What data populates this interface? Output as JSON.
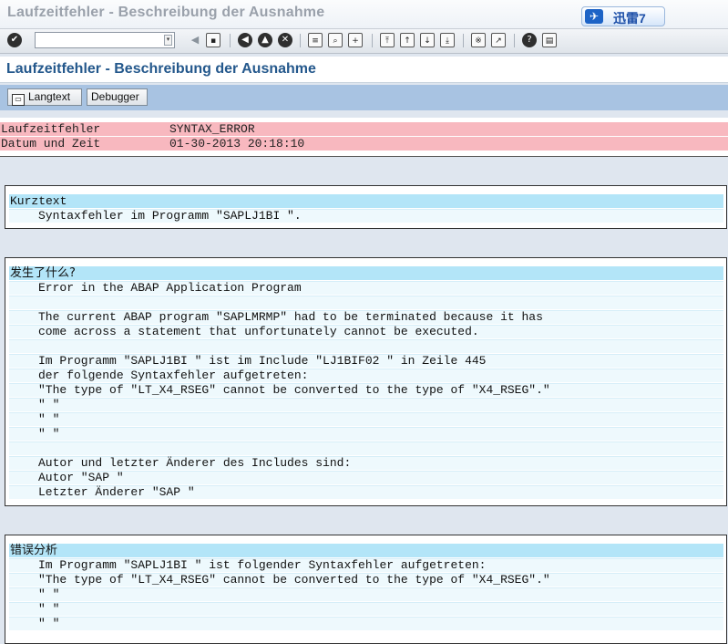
{
  "window": {
    "title": "Laufzeitfehler - Beschreibung der Ausnahme"
  },
  "xunlei": {
    "label": "迅雷7"
  },
  "toolbar": {
    "buttons": [
      "enter-icon",
      "back-icon",
      "save-icon",
      "back-nav-icon",
      "exit-icon",
      "cancel-icon",
      "print-icon",
      "find-icon",
      "find-next-icon",
      "first-page-icon",
      "prev-page-icon",
      "next-page-icon",
      "last-page-icon",
      "new-session-icon",
      "shortcut-icon",
      "help-icon",
      "layout-icon"
    ]
  },
  "page": {
    "heading": "Laufzeitfehler - Beschreibung der Ausnahme"
  },
  "appbar": {
    "langtext": "Langtext",
    "debugger": "Debugger"
  },
  "error": {
    "rows": [
      {
        "key": "Laufzeitfehler",
        "value": "SYNTAX_ERROR"
      },
      {
        "key": "Datum und Zeit",
        "value": "01-30-2013 20:18:10"
      }
    ]
  },
  "kurztext": {
    "title": "Kurztext",
    "lines": [
      "Syntaxfehler im Programm \"SAPLJ1BI \"."
    ]
  },
  "what": {
    "title": "发生了什么?",
    "lines": [
      "Error in the ABAP Application Program",
      "",
      "The current ABAP program \"SAPLMRMP\" had to be terminated because it has",
      "come across a statement that unfortunately cannot be executed.",
      "",
      "Im Programm \"SAPLJ1BI \" ist im Include \"LJ1BIF02 \" in Zeile 445",
      "der folgende Syntaxfehler aufgetreten:",
      "\"The type of \"LT_X4_RSEG\" cannot be converted to the type of \"X4_RSEG\".\"",
      "\" \"",
      "\" \"",
      "\" \"",
      "",
      "Autor und letzter Änderer des Includes sind:",
      "Autor \"SAP \"",
      "Letzter Änderer \"SAP \""
    ]
  },
  "analysis": {
    "title": "错误分析",
    "lines": [
      "Im Programm \"SAPLJ1BI \" ist folgender Syntaxfehler aufgetreten:",
      "\"The type of \"LT_X4_RSEG\" cannot be converted to the type of \"X4_RSEG\".\"",
      "\" \"",
      "\" \"",
      "\" \""
    ]
  }
}
